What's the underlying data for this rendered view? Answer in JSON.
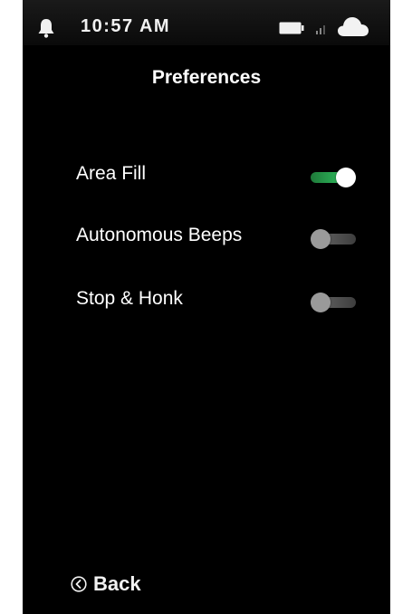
{
  "status_bar": {
    "time": "10:57 AM",
    "icons": [
      "bell-icon",
      "battery-icon",
      "signal-icon",
      "cloud-icon"
    ]
  },
  "page": {
    "title": "Preferences"
  },
  "preferences": [
    {
      "label": "Area Fill",
      "enabled": true
    },
    {
      "label": "Autonomous Beeps",
      "enabled": false
    },
    {
      "label": "Stop & Honk",
      "enabled": false
    }
  ],
  "footer": {
    "back_label": "Back",
    "back_icon": "back-circle-icon"
  },
  "colors": {
    "background": "#000000",
    "toggle_on": "#33d46a",
    "toggle_off": "#555555",
    "text": "#ffffff"
  }
}
